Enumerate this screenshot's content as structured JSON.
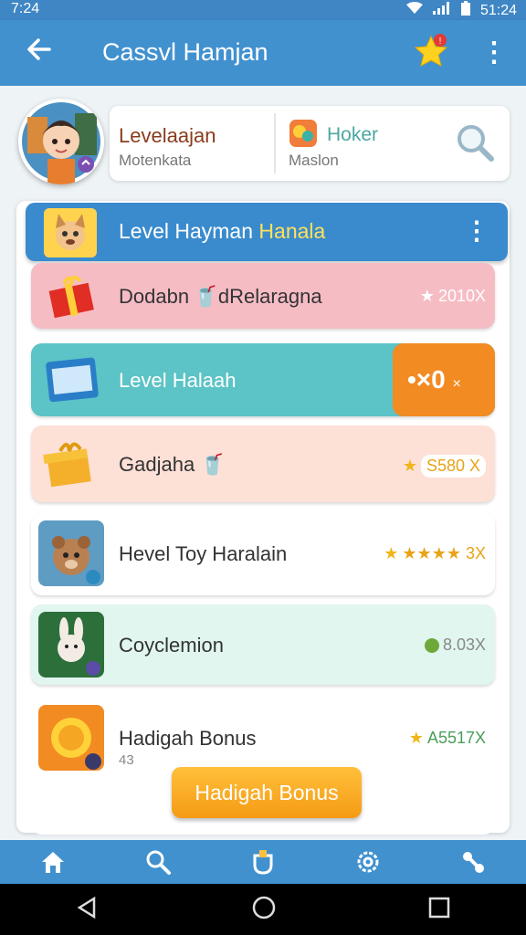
{
  "status": {
    "time": "7:24",
    "right": "51:24"
  },
  "appbar": {
    "title": "Cassvl Hamjan"
  },
  "profile": {
    "name": "Levelaajan",
    "subtitle": "Motenkata",
    "shop_name": "Hoker",
    "shop_subtitle": "Maslon"
  },
  "panel": {
    "title_main": "Level Hayman ",
    "title_highlight": "Hanala"
  },
  "rows": [
    {
      "label": "Dodabn 🥤dRelaragna",
      "value": "2010X"
    },
    {
      "label": "Level Halaah",
      "value": "•×0",
      "x": "×"
    },
    {
      "label": "Gadjaha 🥤",
      "value": "S580 X"
    },
    {
      "label": "Hevel Toy Haralain",
      "value": "★★★★ 3X"
    },
    {
      "label": "Coyclemion",
      "value": "8.03X"
    },
    {
      "label": "Hadigah Bonus",
      "value": "A5517X"
    }
  ],
  "row_small": "43",
  "bonus_button": "Hadigah Bonus",
  "colors": {
    "accent": "#4191cf",
    "orange": "#f59b14"
  }
}
